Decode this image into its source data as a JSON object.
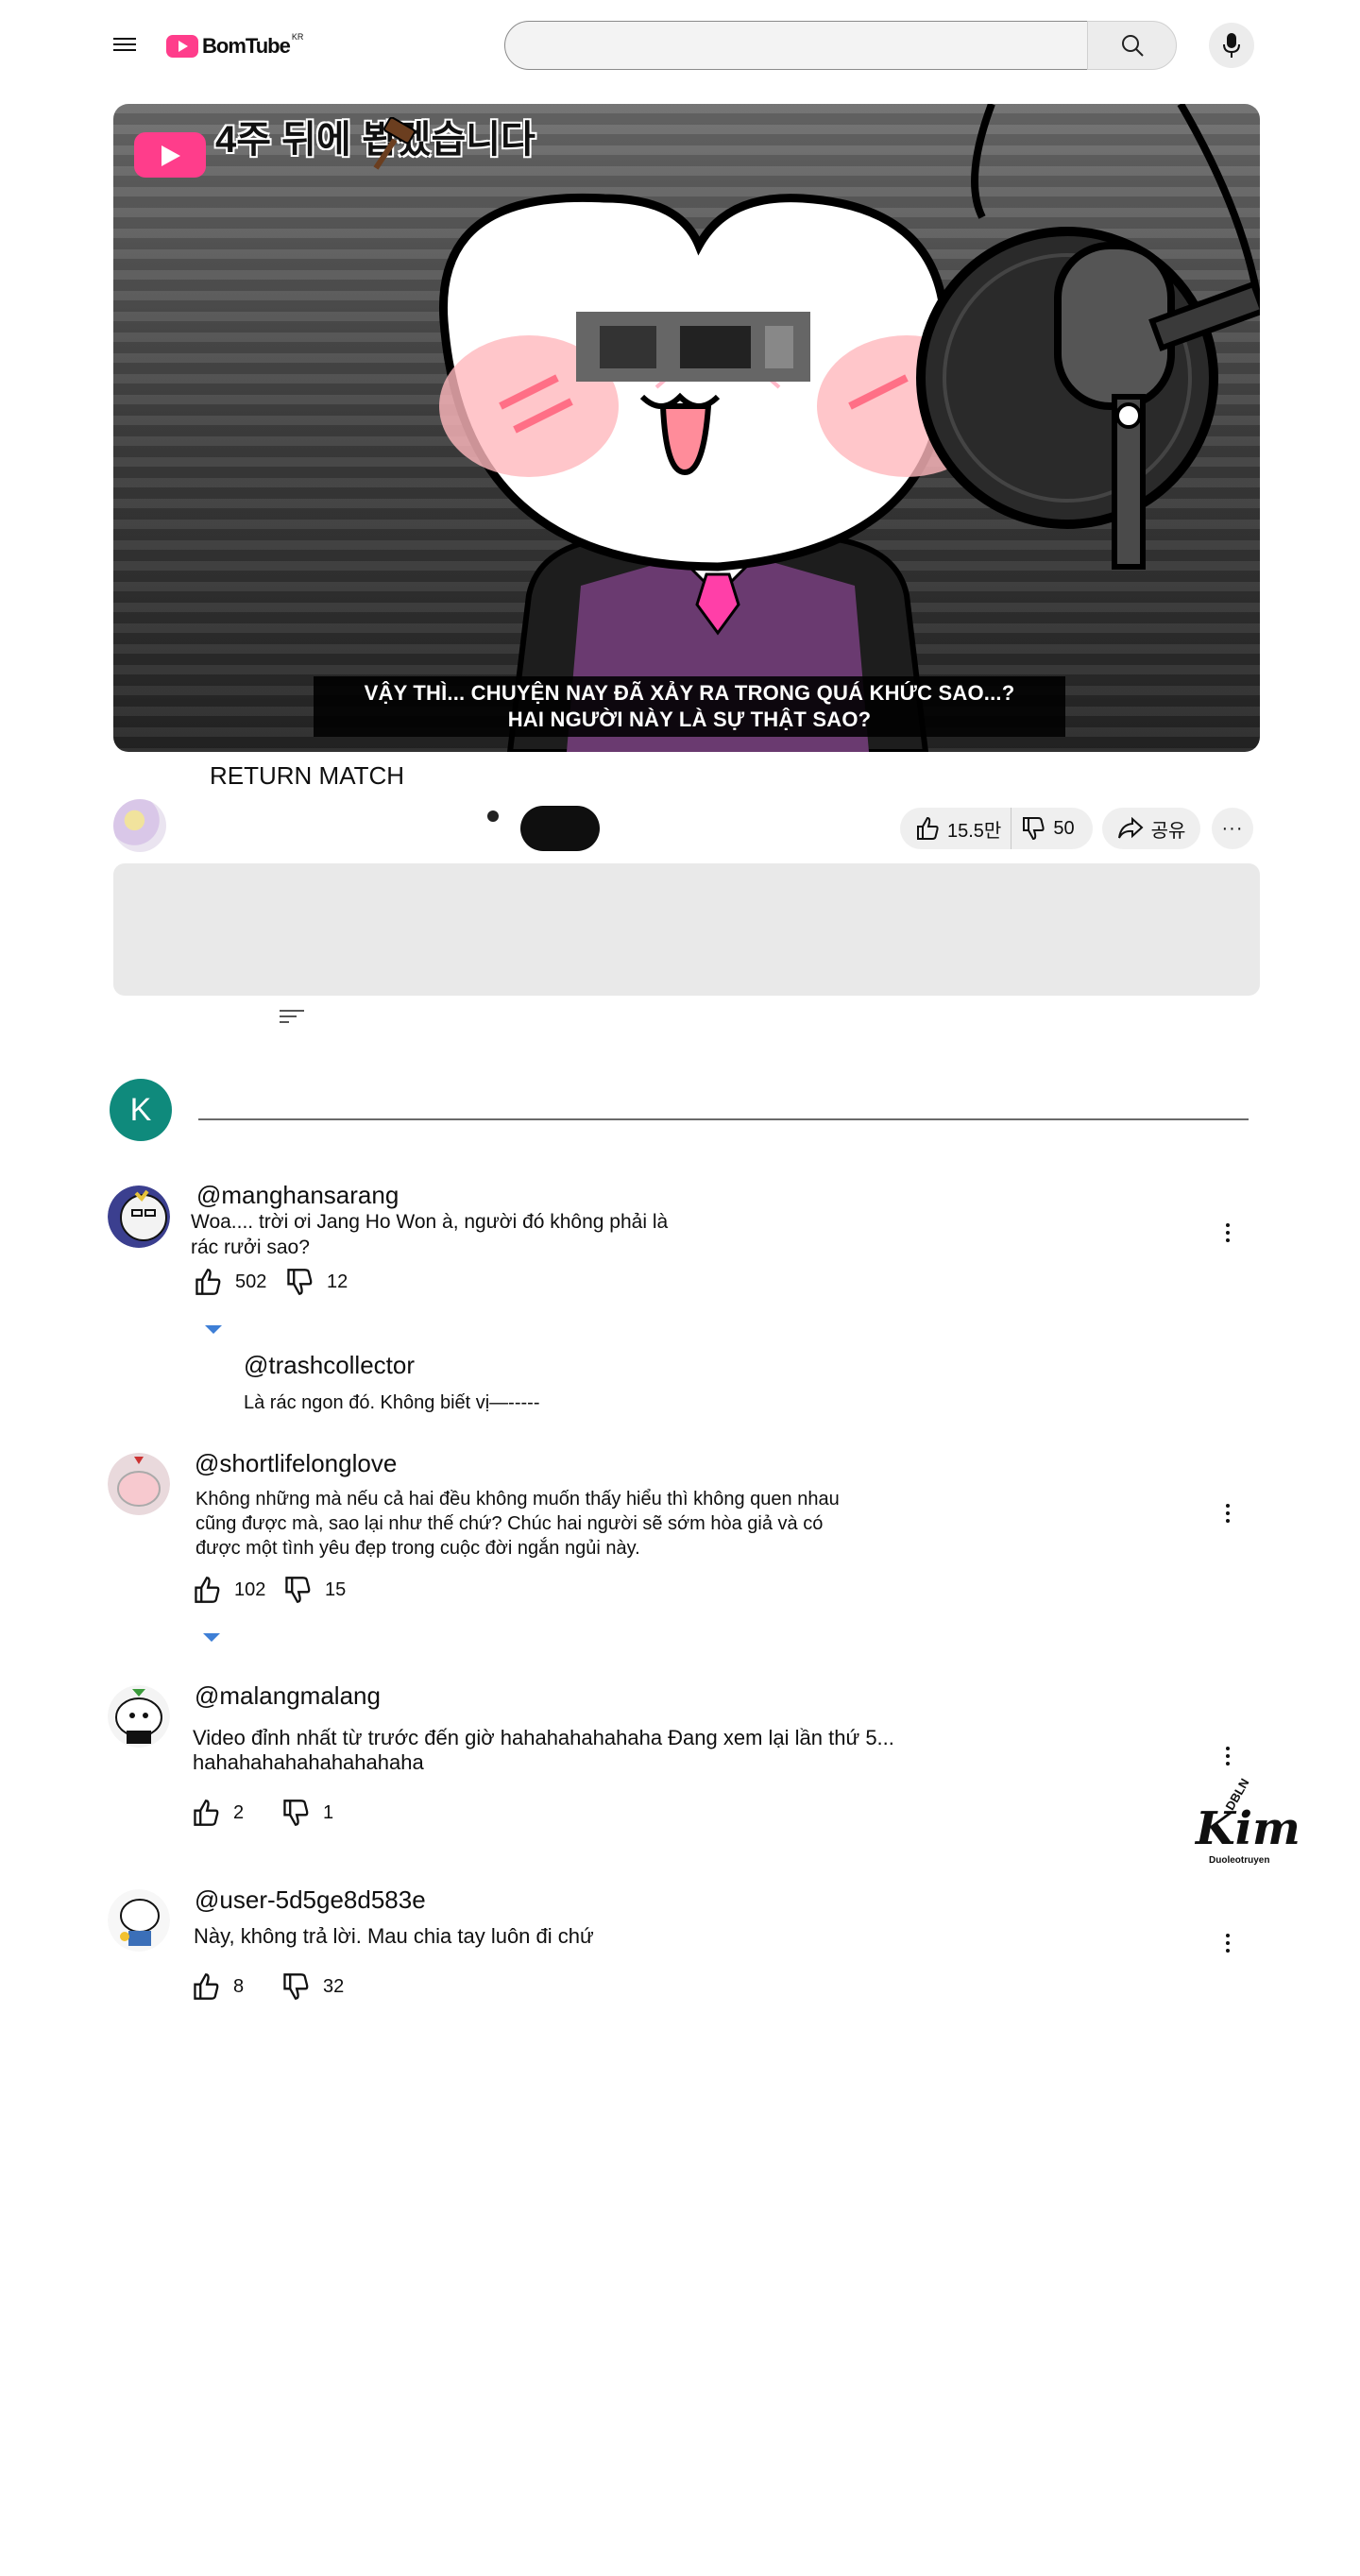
{
  "header": {
    "logo_text": "BomTube",
    "logo_region": "KR",
    "search_placeholder": ""
  },
  "video": {
    "channel_logo_text": "4주 뒤에 뵙겠습니다",
    "subtitle_line1": "VẬY THÌ... CHUYỆN NAY ĐÃ XẢY RA TRONG QUÁ KHỨC SAO...?",
    "subtitle_line2": "HAI NGƯỜI NÀY LÀ SỰ THẬT SAO?"
  },
  "title": "RETURN MATCH",
  "actions": {
    "likes": "15.5만",
    "dislikes": "50",
    "share_label": "공유",
    "more_label": "···"
  },
  "add_comment": {
    "avatar_letter": "K",
    "placeholder": ""
  },
  "comments": [
    {
      "handle": "@manghansarang",
      "text_line1": "Woa.... trời ơi Jang Ho Won à, người đó không phải là",
      "text_line2": "rác rưởi sao?",
      "likes": "502",
      "dislikes": "12",
      "reply": {
        "handle": "@trashcollector",
        "text": "Là rác ngon đó. Không biết vị—-----"
      }
    },
    {
      "handle": "@shortlifelonglove",
      "text_line1": "Không những mà nếu cả hai đều không muốn thấy hiểu thì không quen nhau",
      "text_line2": "cũng được mà, sao lại như thế chứ? Chúc hai người sẽ sớm hòa giả và có",
      "text_line3": "được một tình yêu đẹp trong cuộc đời ngắn ngủi này.",
      "likes": "102",
      "dislikes": "15"
    },
    {
      "handle": "@malangmalang",
      "text_line1": "Video đỉnh nhất từ trước đến giờ hahahahahahaha Đang xem lại lần thứ 5...",
      "text_line2": "hahahahahahahahahaha",
      "likes": "2",
      "dislikes": "1"
    },
    {
      "handle": "@user-5d5ge8d583e",
      "text_line1": "Này, không trả lời. Mau chia tay luôn đi chứ",
      "likes": "8",
      "dislikes": "32"
    }
  ],
  "watermark": {
    "main": "Kim",
    "top": "DBLN",
    "bottom": "Duoleotruyen"
  }
}
